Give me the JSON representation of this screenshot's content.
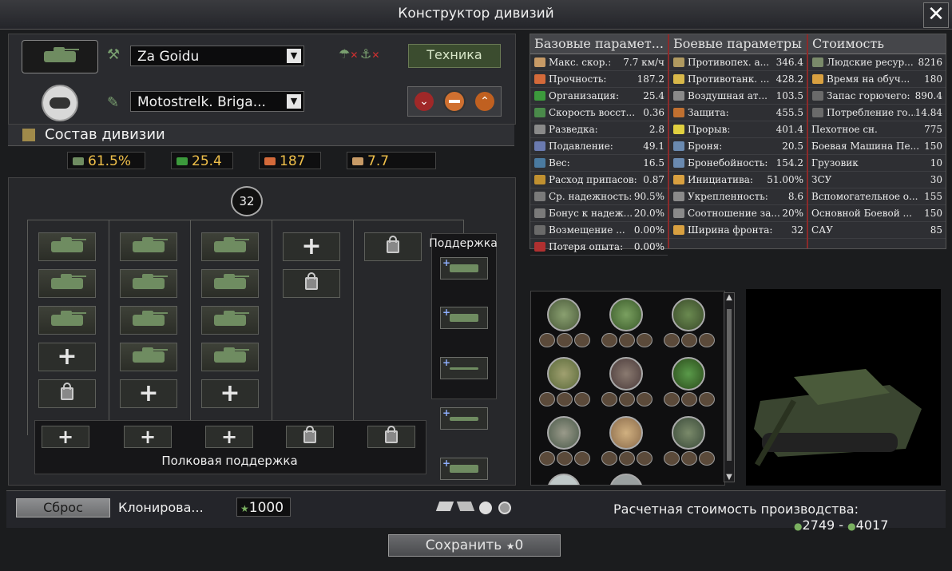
{
  "window": {
    "title": "Конструктор дивизий",
    "close_label": "✕"
  },
  "header": {
    "template_name": "Za Goidu",
    "division_name": "Motostrelk. Briga...",
    "equipment_button": "Техника"
  },
  "composition": {
    "title": "Состав дивизии",
    "stats": {
      "armor_pct": "61.5%",
      "organization": "25.4",
      "hp": "187",
      "speed": "7.7"
    },
    "width_badge": "32",
    "support_label": "Поддержка",
    "regiment_support_label": "Полковая поддержка"
  },
  "stats_table": {
    "headers": [
      "Базовые парамет...",
      "Боевые параметры",
      "Стоимость"
    ],
    "base": [
      {
        "label": "Макс. скор.:",
        "value": "7.7 км/ч",
        "color": "#c79a66"
      },
      {
        "label": "Прочность:",
        "value": "187.2",
        "color": "#d46a3a"
      },
      {
        "label": "Организация:",
        "value": "25.4",
        "color": "#3c9a3c"
      },
      {
        "label": "Скорость восст...",
        "value": "0.36",
        "color": "#4a8a4a"
      },
      {
        "label": "Разведка:",
        "value": "2.8",
        "color": "#8a8a8a"
      },
      {
        "label": "Подавление:",
        "value": "49.1",
        "color": "#6a7ab0"
      },
      {
        "label": "Вес:",
        "value": "16.5",
        "color": "#4a7aa0"
      },
      {
        "label": "Расход припасов:",
        "value": "0.87",
        "color": "#c09030"
      },
      {
        "label": "Ср. надежность:",
        "value": "90.5%",
        "color": "#7a7a7a"
      },
      {
        "label": "Бонус к надеж...",
        "value": "20.0%",
        "color": "#7a7a7a"
      },
      {
        "label": "Возмещение ...",
        "value": "0.00%",
        "color": "#6a6a6a"
      },
      {
        "label": "Потеря опыта:",
        "value": "0.00%",
        "color": "#b03030"
      }
    ],
    "combat": [
      {
        "label": "Противопех. а...",
        "value": "346.4",
        "color": "#b09a60"
      },
      {
        "label": "Противотанк. ...",
        "value": "428.2",
        "color": "#d8b84a"
      },
      {
        "label": "Воздушная ат...",
        "value": "103.5",
        "color": "#8a8a8a"
      },
      {
        "label": "Защита:",
        "value": "455.5",
        "color": "#c07030"
      },
      {
        "label": "Прорыв:",
        "value": "401.4",
        "color": "#e0d040"
      },
      {
        "label": "Броня:",
        "value": "20.5",
        "color": "#6a8ab0"
      },
      {
        "label": "Бронебойность:",
        "value": "154.2",
        "color": "#6a8ab0"
      },
      {
        "label": "Инициатива:",
        "value": "51.00%",
        "color": "#d8a040"
      },
      {
        "label": "Укрепленность:",
        "value": "8.6",
        "color": "#8a8a8a"
      },
      {
        "label": "Соотношение за...",
        "value": "20%",
        "color": "#8a8a8a"
      },
      {
        "label": "Ширина фронта:",
        "value": "32",
        "color": "#d8a040"
      }
    ],
    "cost": [
      {
        "label": "Людские ресур...",
        "value": "8216",
        "color": "#7a8a6a"
      },
      {
        "label": "Время на обуч...",
        "value": "180",
        "color": "#d8a040"
      },
      {
        "label": "Запас горючего:",
        "value": "890.4",
        "color": "#6a6a6a"
      },
      {
        "label": "Потребление го...",
        "value": "14.84",
        "color": "#6a6a6a"
      },
      {
        "label": "Пехотное сн.",
        "value": "775",
        "color": ""
      },
      {
        "label": "Боевая Машина Пе...",
        "value": "150",
        "color": ""
      },
      {
        "label": "Грузовик",
        "value": "10",
        "color": ""
      },
      {
        "label": "ЗСУ",
        "value": "30",
        "color": ""
      },
      {
        "label": "Вспомогательное о...",
        "value": "155",
        "color": ""
      },
      {
        "label": "Основной Боевой ...",
        "value": "150",
        "color": ""
      },
      {
        "label": "САУ",
        "value": "85",
        "color": ""
      }
    ]
  },
  "footer": {
    "reset_button": "Сброс",
    "clone_button": "Клонирова...",
    "xp_value": "1000",
    "production_cost_label": "Расчетная стоимость производства:",
    "cost_min": "2749",
    "cost_separator": "-",
    "cost_max": "4017",
    "save_button": "Сохранить",
    "save_cost": "0"
  },
  "colors": {
    "accent_green": "#3b4c2f",
    "stat_yellow": "#f0c04a",
    "divider_red": "#8b2a2a"
  }
}
